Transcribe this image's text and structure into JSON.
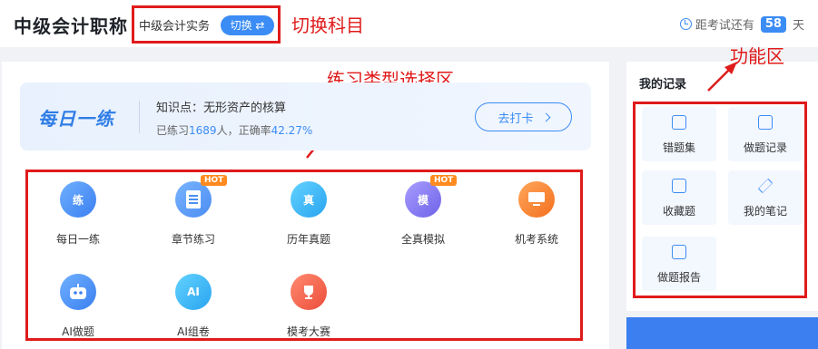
{
  "header": {
    "app_title": "中级会计职称",
    "subject": "中级会计实务",
    "switch_label": "切换 ⇄",
    "countdown_prefix": "距考试还有",
    "countdown_days": "58",
    "countdown_suffix": "天"
  },
  "annotations": {
    "switch_subject": "切换科目",
    "practice_area": "练习类型选择区",
    "function_area": "功能区"
  },
  "daily": {
    "title": "每日一练",
    "topic": "知识点：无形资产的核算",
    "stats_prefix": "已练习",
    "practiced_count": "1689",
    "stats_mid": "人，正确率",
    "accuracy": "42.27%",
    "button": "去打卡"
  },
  "practice_types": [
    {
      "label": "每日一练",
      "icon": "practice-icon",
      "glyph": "练",
      "hot": ""
    },
    {
      "label": "章节练习",
      "icon": "document-icon",
      "glyph": "",
      "hot": "HOT"
    },
    {
      "label": "历年真题",
      "icon": "exam-paper-icon",
      "glyph": "真",
      "hot": ""
    },
    {
      "label": "全真模拟",
      "icon": "mock-exam-icon",
      "glyph": "模",
      "hot": "HOT"
    },
    {
      "label": "机考系统",
      "icon": "computer-icon",
      "glyph": "",
      "hot": ""
    },
    {
      "label": "AI做题",
      "icon": "robot-icon",
      "glyph": "",
      "hot": ""
    },
    {
      "label": "AI组卷",
      "icon": "ai-paper-icon",
      "glyph": "AI",
      "hot": ""
    },
    {
      "label": "模考大赛",
      "icon": "trophy-icon",
      "glyph": "",
      "hot": ""
    }
  ],
  "records": {
    "title": "我的记录",
    "items": [
      {
        "label": "错题集",
        "icon": "wrong-book-icon"
      },
      {
        "label": "做题记录",
        "icon": "history-icon"
      },
      {
        "label": "收藏题",
        "icon": "favorite-icon"
      },
      {
        "label": "我的笔记",
        "icon": "note-pen-icon"
      },
      {
        "label": "做题报告",
        "icon": "report-icon"
      }
    ]
  },
  "colors": {
    "accent": "#3b8cf5",
    "annotation": "#e01b1b",
    "hot": "#ff8a1f"
  }
}
